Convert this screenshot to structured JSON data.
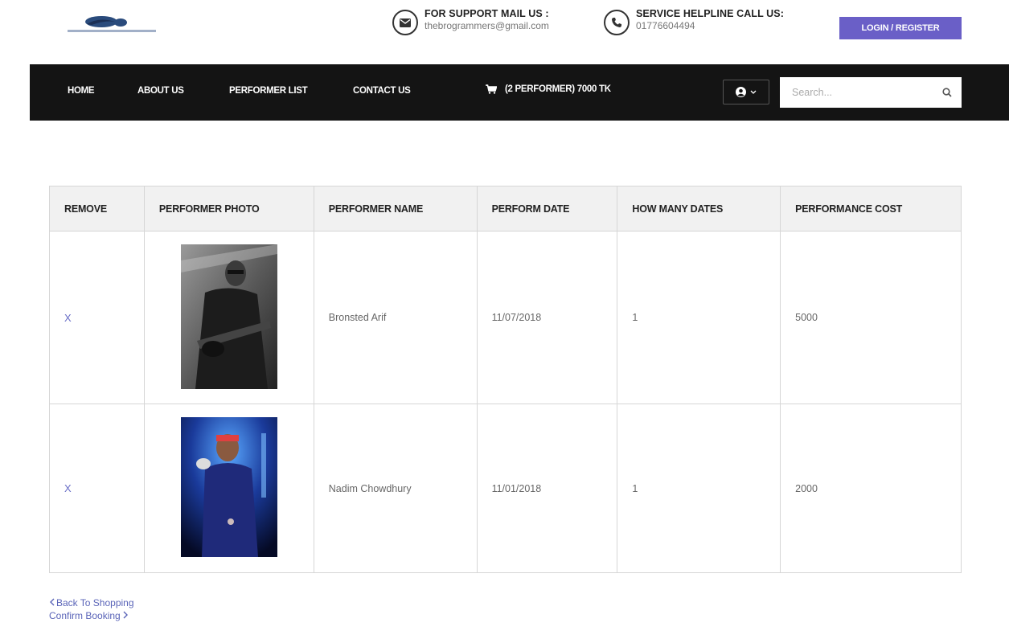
{
  "header": {
    "support": {
      "title": "FOR SUPPORT MAIL US :",
      "email": "thebrogrammers@gmail.com"
    },
    "helpline": {
      "title": "SERVICE HELPLINE CALL US:",
      "phone": "01776604494"
    },
    "login_label": "LOGIN / REGISTER"
  },
  "nav": {
    "items": [
      "HOME",
      "ABOUT US",
      "PERFORMER LIST",
      "CONTACT US"
    ],
    "cart_label": "(2 PERFORMER) 7000 TK",
    "search_placeholder": "Search..."
  },
  "table": {
    "headers": [
      "REMOVE",
      "PERFORMER PHOTO",
      "PERFORMER NAME",
      "PERFORM DATE",
      "HOW MANY DATES",
      "PERFORMANCE COST"
    ],
    "rows": [
      {
        "remove": "X",
        "name": "Bronsted Arif",
        "date": "11/07/2018",
        "dates": "1",
        "cost": "5000"
      },
      {
        "remove": "X",
        "name": "Nadim Chowdhury",
        "date": "11/01/2018",
        "dates": "1",
        "cost": "2000"
      }
    ]
  },
  "links": {
    "back": "Back To Shopping",
    "confirm": "Confirm Booking"
  },
  "colors": {
    "accent": "#6a5fc7",
    "navbar": "#141414",
    "link": "#5a64b8"
  }
}
